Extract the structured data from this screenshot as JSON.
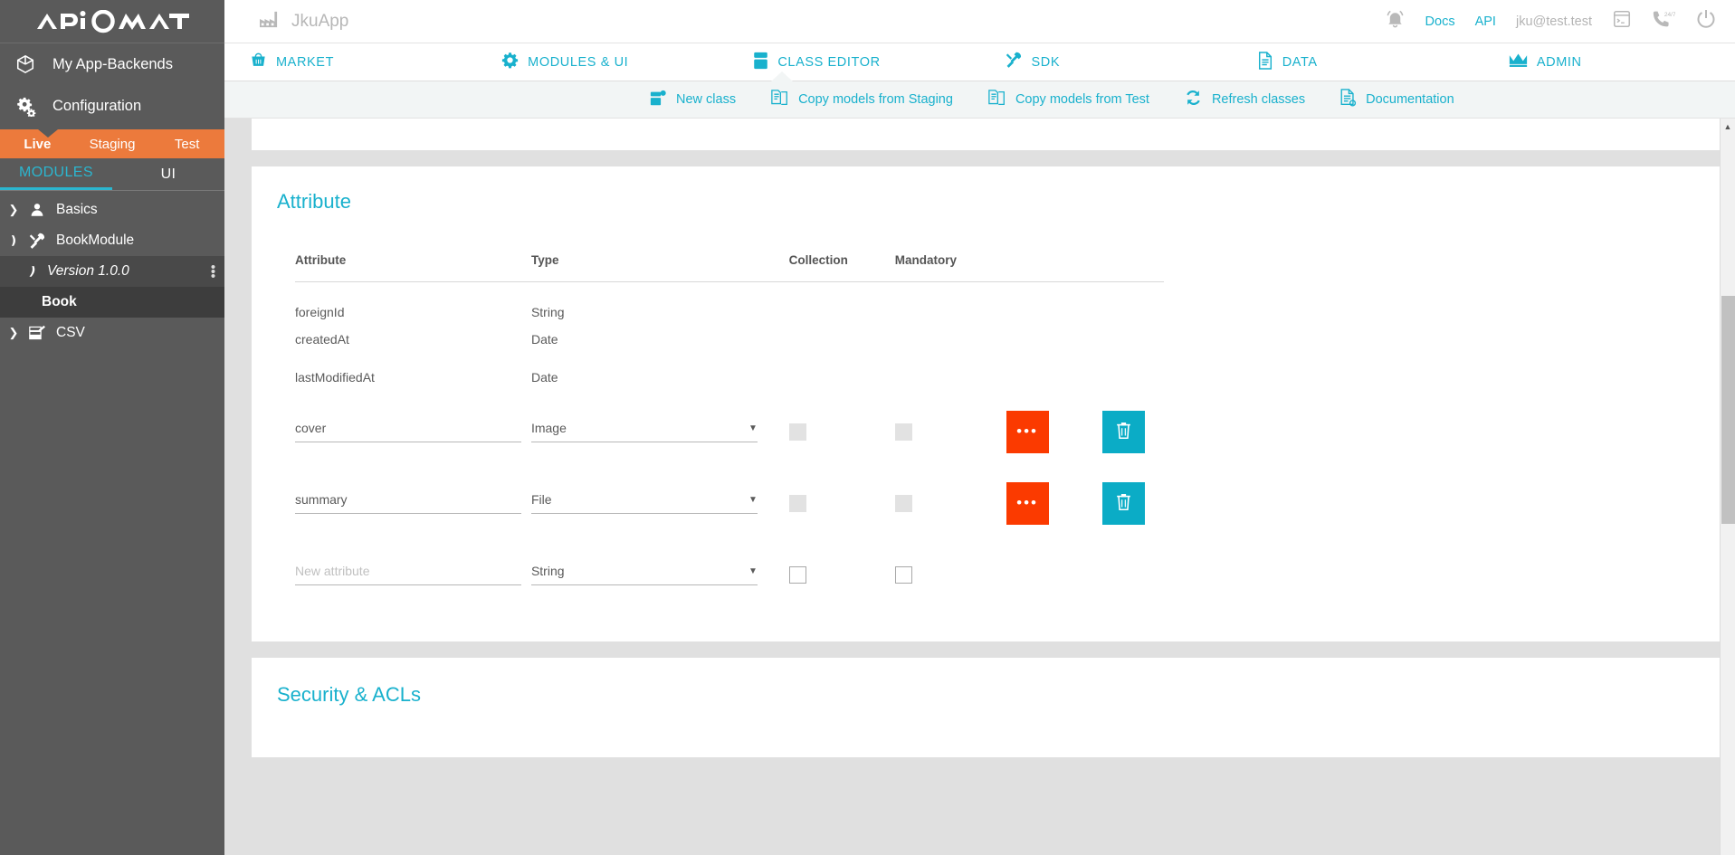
{
  "brand": {
    "logo_text": "APIOMAT"
  },
  "sidebar": {
    "links": [
      {
        "label": "My App-Backends",
        "icon": "cube-icon"
      },
      {
        "label": "Configuration",
        "icon": "gears-icon"
      }
    ],
    "environments": [
      {
        "label": "Live",
        "active": true
      },
      {
        "label": "Staging",
        "active": false
      },
      {
        "label": "Test",
        "active": false
      }
    ],
    "tabs": [
      {
        "label": "MODULES",
        "active": true
      },
      {
        "label": "UI",
        "active": false
      }
    ],
    "tree": [
      {
        "label": "Basics",
        "icon": "person-icon",
        "caret": "collapsed",
        "level": 0
      },
      {
        "label": "BookModule",
        "icon": "tools-icon",
        "caret": "expanded",
        "level": 0
      },
      {
        "label": "Version 1.0.0",
        "icon": "",
        "caret": "expanded",
        "level": 1,
        "menu": "kebab-icon"
      },
      {
        "label": "Book",
        "icon": "",
        "caret": "",
        "level": 2
      },
      {
        "label": "CSV",
        "icon": "csv-icon",
        "caret": "collapsed",
        "level": 0
      }
    ]
  },
  "topbar": {
    "app_name": "JkuApp",
    "app_icon": "factory-icon",
    "bell_icon": "bell-icon",
    "docs_label": "Docs",
    "api_label": "API",
    "user_label": "jku@test.test",
    "terminal_icon": "terminal-icon",
    "support_icon": "phone-247-icon",
    "power_icon": "power-icon"
  },
  "navbar": {
    "items": [
      {
        "label": "MARKET",
        "icon": "basket-icon",
        "active": false
      },
      {
        "label": "MODULES & UI",
        "icon": "gear-icon",
        "active": false
      },
      {
        "label": "CLASS EDITOR",
        "icon": "class-icon",
        "active": true
      },
      {
        "label": "SDK",
        "icon": "tools-icon",
        "active": false
      },
      {
        "label": "DATA",
        "icon": "document-icon",
        "active": false
      },
      {
        "label": "ADMIN",
        "icon": "crown-icon",
        "active": false
      }
    ]
  },
  "subbar": {
    "items": [
      {
        "label": "New class",
        "icon": "new-class-icon"
      },
      {
        "label": "Copy models from Staging",
        "icon": "copy-icon"
      },
      {
        "label": "Copy models from Test",
        "icon": "copy-icon"
      },
      {
        "label": "Refresh classes",
        "icon": "refresh-icon"
      },
      {
        "label": "Documentation",
        "icon": "documentation-icon"
      }
    ]
  },
  "main": {
    "attribute_card": {
      "title": "Attribute",
      "columns": [
        "Attribute",
        "Type",
        "Collection",
        "Mandatory"
      ],
      "rows": [
        {
          "attribute": "foreignId",
          "type": "String",
          "editable": false,
          "collection": null,
          "mandatory": null
        },
        {
          "attribute": "createdAt",
          "type": "Date",
          "editable": false,
          "collection": null,
          "mandatory": null
        },
        {
          "attribute": "lastModifiedAt",
          "type": "Date",
          "editable": false,
          "collection": null,
          "mandatory": null
        },
        {
          "attribute": "cover",
          "type": "Image",
          "editable": true,
          "collection": false,
          "mandatory": false,
          "checkbox_state": "disabled",
          "more_label": "•••",
          "delete_icon": "trash-icon"
        },
        {
          "attribute": "summary",
          "type": "File",
          "editable": true,
          "collection": false,
          "mandatory": false,
          "checkbox_state": "disabled",
          "more_label": "•••",
          "delete_icon": "trash-icon"
        },
        {
          "attribute": "",
          "attribute_placeholder": "New attribute",
          "type": "String",
          "editable": true,
          "collection": false,
          "mandatory": false,
          "checkbox_state": "enabled"
        }
      ]
    },
    "security_card": {
      "title": "Security & ACLs"
    }
  },
  "colors": {
    "accent_cyan": "#19b1cd",
    "accent_orange": "#ec7a3c",
    "button_orange": "#fb3a00",
    "button_cyan": "#0bacc6",
    "sidebar_bg": "#5a5a5a"
  },
  "scrollbar": {
    "up_arrow": "▲"
  }
}
